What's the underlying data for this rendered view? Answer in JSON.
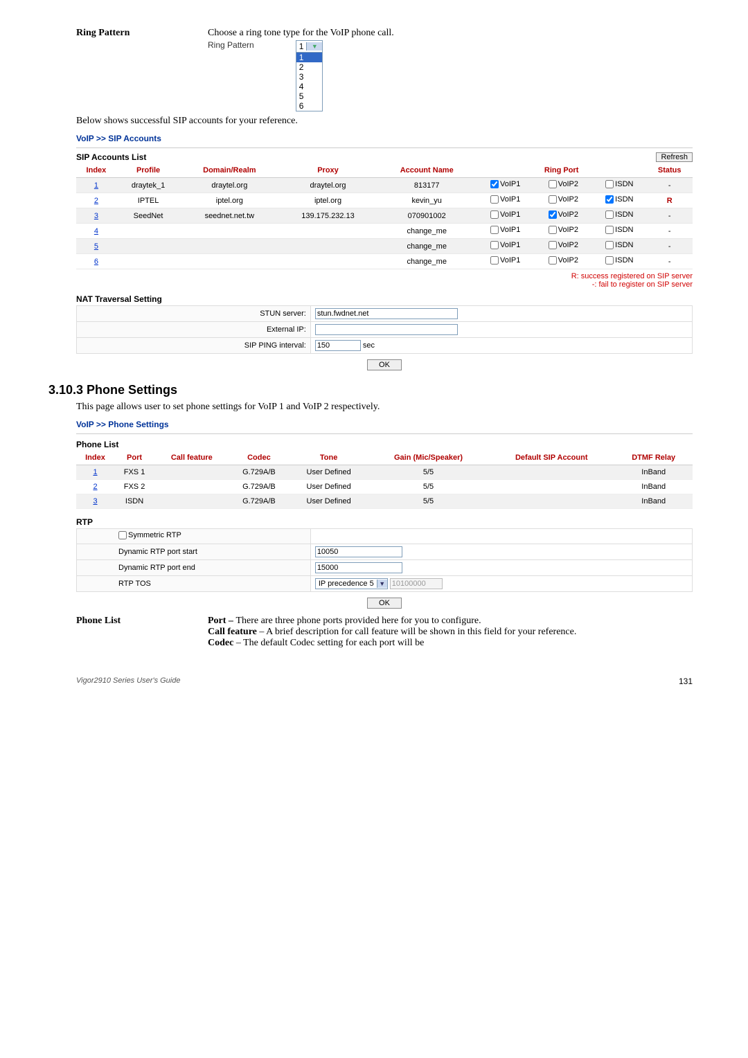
{
  "ringPattern": {
    "label": "Ring Pattern",
    "desc": "Choose a ring tone type for the VoIP phone call.",
    "fieldLabel": "Ring Pattern",
    "selected": "1",
    "options": [
      "1",
      "2",
      "3",
      "4",
      "5",
      "6"
    ]
  },
  "sipIntro": "Below shows successful SIP accounts for your reference.",
  "breadcrumb1": "VoIP >> SIP Accounts",
  "sipList": {
    "title": "SIP Accounts List",
    "refresh": "Refresh",
    "headers": {
      "index": "Index",
      "profile": "Profile",
      "domain": "Domain/Realm",
      "proxy": "Proxy",
      "account": "Account Name",
      "ring": "Ring Port",
      "status": "Status"
    },
    "rows": [
      {
        "idx": "1",
        "profile": "draytek_1",
        "domain": "draytel.org",
        "proxy": "draytel.org",
        "account": "813177",
        "v1": true,
        "v2": false,
        "isdn": false,
        "status": "-"
      },
      {
        "idx": "2",
        "profile": "IPTEL",
        "domain": "iptel.org",
        "proxy": "iptel.org",
        "account": "kevin_yu",
        "v1": false,
        "v2": false,
        "isdn": true,
        "status": "R"
      },
      {
        "idx": "3",
        "profile": "SeedNet",
        "domain": "seednet.net.tw",
        "proxy": "139.175.232.13",
        "account": "070901002",
        "v1": false,
        "v2": true,
        "isdn": false,
        "status": "-"
      },
      {
        "idx": "4",
        "profile": "",
        "domain": "",
        "proxy": "",
        "account": "change_me",
        "v1": false,
        "v2": false,
        "isdn": false,
        "status": "-"
      },
      {
        "idx": "5",
        "profile": "",
        "domain": "",
        "proxy": "",
        "account": "change_me",
        "v1": false,
        "v2": false,
        "isdn": false,
        "status": "-"
      },
      {
        "idx": "6",
        "profile": "",
        "domain": "",
        "proxy": "",
        "account": "change_me",
        "v1": false,
        "v2": false,
        "isdn": false,
        "status": "-"
      }
    ],
    "portLabels": {
      "v1": "VoIP1",
      "v2": "VoIP2",
      "isdn": "ISDN"
    },
    "legendR": "R: success registered on SIP server",
    "legendF": "-: fail to register on SIP server"
  },
  "nat": {
    "title": "NAT Traversal Setting",
    "stunLabel": "STUN server:",
    "stunVal": "stun.fwdnet.net",
    "extLabel": "External IP:",
    "extVal": "",
    "pingLabel": "SIP PING interval:",
    "pingVal": "150",
    "pingUnit": "sec"
  },
  "ok": "OK",
  "section": {
    "num": "3.10.3 Phone Settings",
    "desc": "This page allows user to set phone settings for VoIP 1 and VoIP 2 respectively."
  },
  "breadcrumb2": "VoIP >> Phone Settings",
  "phoneList": {
    "title": "Phone List",
    "headers": {
      "index": "Index",
      "port": "Port",
      "call": "Call feature",
      "codec": "Codec",
      "tone": "Tone",
      "gain": "Gain (Mic/Speaker)",
      "def": "Default SIP Account",
      "dtmf": "DTMF Relay"
    },
    "rows": [
      {
        "idx": "1",
        "port": "FXS 1",
        "codec": "G.729A/B",
        "tone": "User Defined",
        "gain": "5/5",
        "def": "",
        "dtmf": "InBand"
      },
      {
        "idx": "2",
        "port": "FXS 2",
        "codec": "G.729A/B",
        "tone": "User Defined",
        "gain": "5/5",
        "def": "",
        "dtmf": "InBand"
      },
      {
        "idx": "3",
        "port": "ISDN",
        "codec": "G.729A/B",
        "tone": "User Defined",
        "gain": "5/5",
        "def": "",
        "dtmf": "InBand"
      }
    ]
  },
  "rtp": {
    "title": "RTP",
    "sym": "Symmetric RTP",
    "startLabel": "Dynamic RTP port start",
    "startVal": "10050",
    "endLabel": "Dynamic RTP port end",
    "endVal": "15000",
    "tosLabel": "RTP TOS",
    "tosSel": "IP precedence 5",
    "tosBin": "10100000"
  },
  "phoneDesc": {
    "heading": "Phone List",
    "portLabel": "Port – ",
    "portText": "There are three phone ports provided here for you to configure.",
    "callLabel": "Call feature",
    "callText": " – A brief description for call feature will be shown in this field for your reference.",
    "codecLabel": "Codec",
    "codecText": " – The default Codec setting for each port will be"
  },
  "footer": {
    "guide": "Vigor2910 Series User's Guide",
    "page": "131"
  }
}
